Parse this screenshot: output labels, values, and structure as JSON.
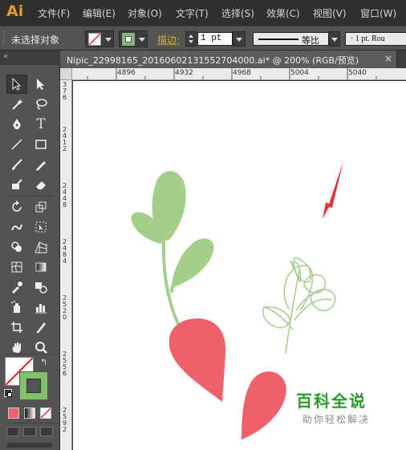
{
  "app": {
    "logo": "Ai"
  },
  "menu": [
    "文件(F)",
    "编辑(E)",
    "对象(O)",
    "文字(T)",
    "选择(S)",
    "效果(C)",
    "视图(V)",
    "窗口(W)"
  ],
  "control": {
    "selection_status": "未选择对象",
    "stroke_label": "描边:",
    "stroke_weight": "1 pt",
    "profile_label": "等比",
    "brush_label": "· 1 pt. Rou"
  },
  "document": {
    "tab_title": "Nipic_22998165_20160602131552704000.ai*  @  200%  (RGB/预览)",
    "close": "×"
  },
  "rulers": {
    "horizontal": [
      "4896",
      "4932",
      "4968",
      "5004",
      "5040"
    ],
    "vertical": [
      "3 7 6",
      "2 4 1 2",
      "2 4 4 8",
      "2 4 8 4",
      "2 5 2 0",
      "2 5 5 6",
      "2 5 9 2"
    ]
  },
  "colors": {
    "leaf_green": "#a3cf8a",
    "radish_red": "#f0606a",
    "arrow_red": "#e03838",
    "stroke_swatch": "#7fc06a"
  },
  "tools": [
    "selection-tool",
    "direct-selection-tool",
    "magic-wand-tool",
    "lasso-tool",
    "pen-tool",
    "type-tool",
    "line-tool",
    "rectangle-tool",
    "paintbrush-tool",
    "pencil-tool",
    "blob-brush-tool",
    "eraser-tool",
    "rotate-tool",
    "scale-tool",
    "warp-tool",
    "free-transform-tool",
    "shape-builder-tool",
    "perspective-grid-tool",
    "mesh-tool",
    "gradient-tool",
    "eyedropper-tool",
    "blend-tool",
    "symbol-sprayer-tool",
    "column-graph-tool",
    "artboard-tool",
    "slice-tool",
    "hand-tool",
    "zoom-tool"
  ],
  "watermark": {
    "title": "百科全说",
    "subtitle": "助你轻松解决"
  }
}
